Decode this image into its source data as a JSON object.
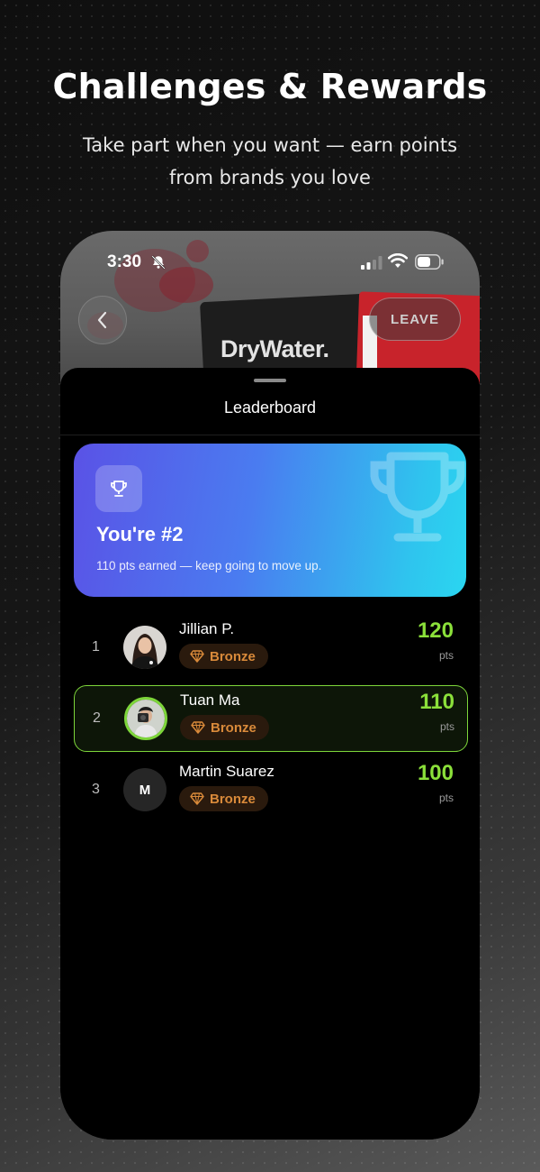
{
  "hero": {
    "title": "Challenges & Rewards",
    "subtitle": "Take part when you want — earn points from brands you love"
  },
  "status_bar": {
    "time": "3:30"
  },
  "header": {
    "brand": "DryWater.",
    "leave_label": "LEAVE"
  },
  "leaderboard": {
    "title": "Leaderboard",
    "rank_card": {
      "title": "You're #2",
      "subtitle": "110 pts earned — keep going to move up."
    },
    "entries": [
      {
        "rank": "1",
        "name": "Jillian P.",
        "tier": "Bronze",
        "points": "120",
        "unit": "pts"
      },
      {
        "rank": "2",
        "name": "Tuan Ma",
        "tier": "Bronze",
        "points": "110",
        "unit": "pts"
      },
      {
        "rank": "3",
        "name": "Martin Suarez",
        "initial": "M",
        "tier": "Bronze",
        "points": "100",
        "unit": "pts"
      }
    ]
  },
  "colors": {
    "accent_green": "#8be03a",
    "bronze": "#d98a3a",
    "card_gradient_start": "#5a52e6",
    "card_gradient_end": "#2ad6f0"
  },
  "icons": [
    "bell-muted-icon",
    "signal-icon",
    "wifi-icon",
    "battery-icon",
    "chevron-left-icon",
    "trophy-icon",
    "diamond-icon"
  ]
}
